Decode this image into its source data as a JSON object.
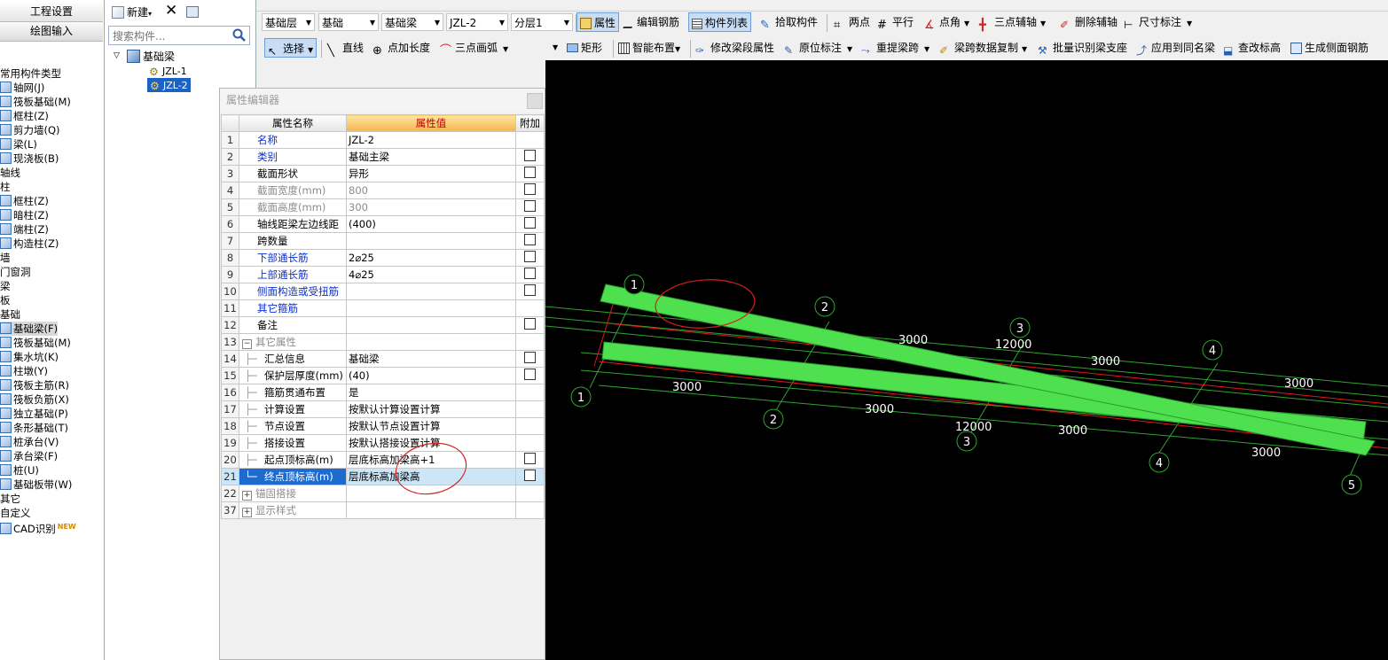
{
  "leftnav": {
    "btn_project": "工程设置",
    "btn_draw": "绘图输入",
    "items": [
      {
        "label": "常用构件类型",
        "icon": ""
      },
      {
        "label": "轴网(J)",
        "icon": "axis-grid-icon"
      },
      {
        "label": "筏板基础(M)",
        "icon": "raft-foundation-icon"
      },
      {
        "label": "框柱(Z)",
        "icon": "frame-column-icon"
      },
      {
        "label": "剪力墙(Q)",
        "icon": "shear-wall-icon"
      },
      {
        "label": "梁(L)",
        "icon": "beam-icon"
      },
      {
        "label": "现浇板(B)",
        "icon": "slab-icon"
      },
      {
        "label": "轴线",
        "icon": ""
      },
      {
        "label": "柱",
        "icon": ""
      },
      {
        "label": "框柱(Z)",
        "icon": "frame-column-icon"
      },
      {
        "label": "暗柱(Z)",
        "icon": "hidden-column-icon"
      },
      {
        "label": "端柱(Z)",
        "icon": "end-column-icon"
      },
      {
        "label": "构造柱(Z)",
        "icon": "structural-column-icon"
      },
      {
        "label": "墙",
        "icon": ""
      },
      {
        "label": "门窗洞",
        "icon": ""
      },
      {
        "label": "梁",
        "icon": ""
      },
      {
        "label": "板",
        "icon": ""
      },
      {
        "label": "基础",
        "icon": ""
      },
      {
        "label": "基础梁(F)",
        "icon": "foundation-beam-icon"
      },
      {
        "label": "筏板基础(M)",
        "icon": "raft-foundation-icon"
      },
      {
        "label": "集水坑(K)",
        "icon": "sump-pit-icon"
      },
      {
        "label": "柱墩(Y)",
        "icon": "column-pier-icon"
      },
      {
        "label": "筏板主筋(R)",
        "icon": "raft-main-rebar-icon"
      },
      {
        "label": "筏板负筋(X)",
        "icon": "raft-negative-rebar-icon"
      },
      {
        "label": "独立基础(P)",
        "icon": "isolated-footing-icon"
      },
      {
        "label": "条形基础(T)",
        "icon": "strip-footing-icon"
      },
      {
        "label": "桩承台(V)",
        "icon": "pile-cap-icon"
      },
      {
        "label": "承台梁(F)",
        "icon": "cap-beam-icon"
      },
      {
        "label": "桩(U)",
        "icon": "pile-icon"
      },
      {
        "label": "基础板带(W)",
        "icon": "foundation-strip-icon"
      },
      {
        "label": "其它",
        "icon": ""
      },
      {
        "label": "自定义",
        "icon": ""
      },
      {
        "label": "CAD识别",
        "icon": "cad-icon"
      }
    ],
    "new_badge": "NEW"
  },
  "comppanel": {
    "new_label": "新建",
    "search_placeholder": "搜索构件...",
    "tree_root": "基础梁",
    "tree_items": [
      "JZL-1",
      "JZL-2"
    ]
  },
  "toolbar": {
    "row1": {
      "floor": "基础层",
      "category": "基础",
      "type": "基础梁",
      "component": "JZL-2",
      "layer": "分层1",
      "btn_property": "属性",
      "btn_edit_rebar": "编辑钢筋",
      "btn_component_list": "构件列表",
      "btn_pick": "拾取构件",
      "btn_two_points": "两点",
      "btn_parallel": "平行",
      "btn_point_angle": "点角",
      "btn_three_point_axis": "三点辅轴",
      "btn_delete_axis": "删除辅轴",
      "btn_dimension": "尺寸标注"
    },
    "row2": {
      "btn_select": "选择",
      "btn_line": "直线",
      "btn_point_length": "点加长度",
      "btn_three_arc": "三点画弧",
      "btn_rect": "矩形",
      "btn_smart_layout": "智能布置",
      "btn_modify_segment": "修改梁段属性",
      "btn_origin_mark": "原位标注",
      "btn_re_span": "重提梁跨",
      "btn_span_copy": "梁跨数据复制",
      "btn_batch_identify": "批量识别梁支座",
      "btn_apply_same": "应用到同名梁",
      "btn_check_elev": "查改标高",
      "btn_side_rebar": "生成侧面钢筋"
    }
  },
  "dialog": {
    "title": "属性编辑器",
    "col_name": "属性名称",
    "col_value": "属性值",
    "col_extra": "附加",
    "rows": [
      {
        "n": "1",
        "name": "名称",
        "value": "JZL-2",
        "style": "blue",
        "cb": false,
        "tree": ""
      },
      {
        "n": "2",
        "name": "类别",
        "value": "基础主梁",
        "style": "blue",
        "cb": true,
        "tree": ""
      },
      {
        "n": "3",
        "name": "截面形状",
        "value": "异形",
        "style": "",
        "cb": true,
        "tree": ""
      },
      {
        "n": "4",
        "name": "截面宽度(mm)",
        "value": "800",
        "style": "grey",
        "cb": true,
        "tree": ""
      },
      {
        "n": "5",
        "name": "截面高度(mm)",
        "value": "300",
        "style": "grey",
        "cb": true,
        "tree": ""
      },
      {
        "n": "6",
        "name": "轴线距梁左边线距",
        "value": "(400)",
        "style": "",
        "cb": true,
        "tree": ""
      },
      {
        "n": "7",
        "name": "跨数量",
        "value": "",
        "style": "",
        "cb": true,
        "tree": ""
      },
      {
        "n": "8",
        "name": "下部通长筋",
        "value": "2⌀25",
        "style": "blue",
        "cb": true,
        "tree": ""
      },
      {
        "n": "9",
        "name": "上部通长筋",
        "value": "4⌀25",
        "style": "blue",
        "cb": true,
        "tree": ""
      },
      {
        "n": "10",
        "name": "侧面构造或受扭筋",
        "value": "",
        "style": "blue",
        "cb": true,
        "tree": ""
      },
      {
        "n": "11",
        "name": "其它箍筋",
        "value": "",
        "style": "blue",
        "cb": false,
        "tree": ""
      },
      {
        "n": "12",
        "name": "备注",
        "value": "",
        "style": "",
        "cb": true,
        "tree": ""
      },
      {
        "n": "13",
        "name": "其它属性",
        "value": "",
        "style": "grey",
        "cb": false,
        "tree": "minus"
      },
      {
        "n": "14",
        "name": "汇总信息",
        "value": "基础梁",
        "style": "",
        "cb": true,
        "tree": "child"
      },
      {
        "n": "15",
        "name": "保护层厚度(mm)",
        "value": "(40)",
        "style": "",
        "cb": true,
        "tree": "child"
      },
      {
        "n": "16",
        "name": "箍筋贯通布置",
        "value": "是",
        "style": "",
        "cb": false,
        "tree": "child"
      },
      {
        "n": "17",
        "name": "计算设置",
        "value": "按默认计算设置计算",
        "style": "",
        "cb": false,
        "tree": "child"
      },
      {
        "n": "18",
        "name": "节点设置",
        "value": "按默认节点设置计算",
        "style": "",
        "cb": false,
        "tree": "child"
      },
      {
        "n": "19",
        "name": "搭接设置",
        "value": "按默认搭接设置计算",
        "style": "",
        "cb": false,
        "tree": "child"
      },
      {
        "n": "20",
        "name": "起点顶标高(m)",
        "value": "层底标高加梁高+1",
        "style": "",
        "cb": true,
        "tree": "child"
      },
      {
        "n": "21",
        "name": "终点顶标高(m)",
        "value": "层底标高加梁高",
        "style": "",
        "cb": true,
        "tree": "childlast",
        "selected": true
      },
      {
        "n": "22",
        "name": "锚固搭接",
        "value": "",
        "style": "grey",
        "cb": false,
        "tree": "plus"
      },
      {
        "n": "37",
        "name": "显示样式",
        "value": "",
        "style": "grey",
        "cb": false,
        "tree": "plus"
      }
    ]
  },
  "canvas": {
    "axis_labels_top": [
      "1",
      "2",
      "3",
      "4"
    ],
    "axis_labels_bottom": [
      "1",
      "2",
      "3",
      "4",
      "5"
    ],
    "dims": [
      "3000",
      "12000",
      "3000",
      "3000",
      "3000",
      "3000",
      "12000",
      "3000",
      "3000"
    ],
    "beam_color": "#4ee04e",
    "axis_line_color": "#2fa32f",
    "ref_line_color": "#e01818",
    "markup_color": "#d21f1f"
  }
}
